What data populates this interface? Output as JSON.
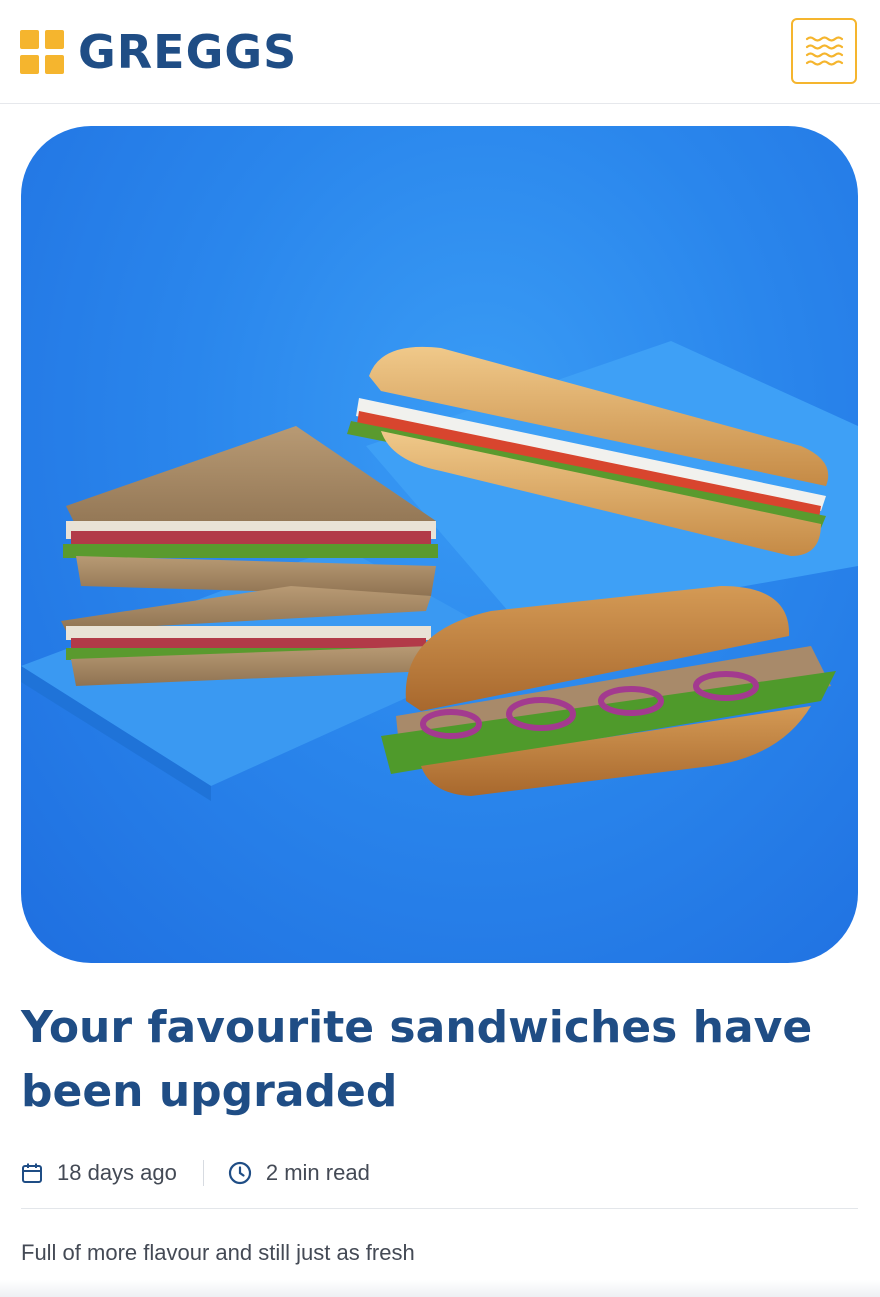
{
  "brand": {
    "name": "GREGGS",
    "accent_color": "#f5b52e",
    "text_color": "#1f4d85"
  },
  "header": {
    "menu_icon": "menu-wave-icon"
  },
  "hero": {
    "image_description": "sandwiches-on-blue-background"
  },
  "article": {
    "title": "Your favourite sandwiches have been upgraded",
    "date_icon": "calendar-icon",
    "date": "18 days ago",
    "read_icon": "clock-icon",
    "read_time": "2 min read",
    "summary": "Full of more flavour and still just as fresh"
  }
}
